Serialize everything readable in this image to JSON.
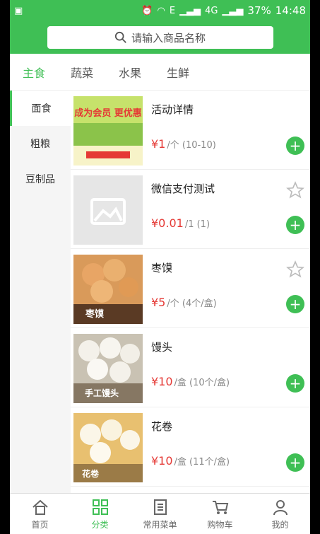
{
  "status_bar": {
    "battery": "37%",
    "time": "14:48",
    "network": "4G",
    "sim": "E"
  },
  "search": {
    "placeholder": "请输入商品名称"
  },
  "tabs": [
    {
      "label": "主食",
      "active": true
    },
    {
      "label": "蔬菜",
      "active": false
    },
    {
      "label": "水果",
      "active": false
    },
    {
      "label": "生鲜",
      "active": false
    }
  ],
  "sidebar": [
    {
      "label": "面食",
      "active": true
    },
    {
      "label": "粗粮",
      "active": false
    },
    {
      "label": "豆制品",
      "active": false
    }
  ],
  "products": [
    {
      "name": "活动详情",
      "price": "¥1",
      "unit": "/个 (10-10)",
      "image": "promo-banner",
      "thumb_text": "成为会员 更优惠"
    },
    {
      "name": "微信支付测试",
      "price": "¥0.01",
      "unit": "/1 (1)",
      "image": "placeholder",
      "favorite": false
    },
    {
      "name": "枣馍",
      "price": "¥5",
      "unit": "/个 (4个/盒)",
      "image": "buns-red-date",
      "favorite": false,
      "thumb_text": "枣馍"
    },
    {
      "name": "馒头",
      "price": "¥10",
      "unit": "/盒 (10个/盒)",
      "image": "steamed-buns",
      "thumb_text": "手工馒头"
    },
    {
      "name": "花卷",
      "price": "¥10",
      "unit": "/盒 (11个/盒)",
      "image": "flower-rolls",
      "thumb_text": "花卷"
    }
  ],
  "bottom_nav": [
    {
      "label": "首页",
      "icon": "home-icon",
      "active": false
    },
    {
      "label": "分类",
      "icon": "grid-icon",
      "active": true
    },
    {
      "label": "常用菜单",
      "icon": "list-icon",
      "active": false
    },
    {
      "label": "购物车",
      "icon": "cart-icon",
      "active": false
    },
    {
      "label": "我的",
      "icon": "user-icon",
      "active": false
    }
  ],
  "colors": {
    "brand": "#3fbf55",
    "price": "#e53935"
  }
}
